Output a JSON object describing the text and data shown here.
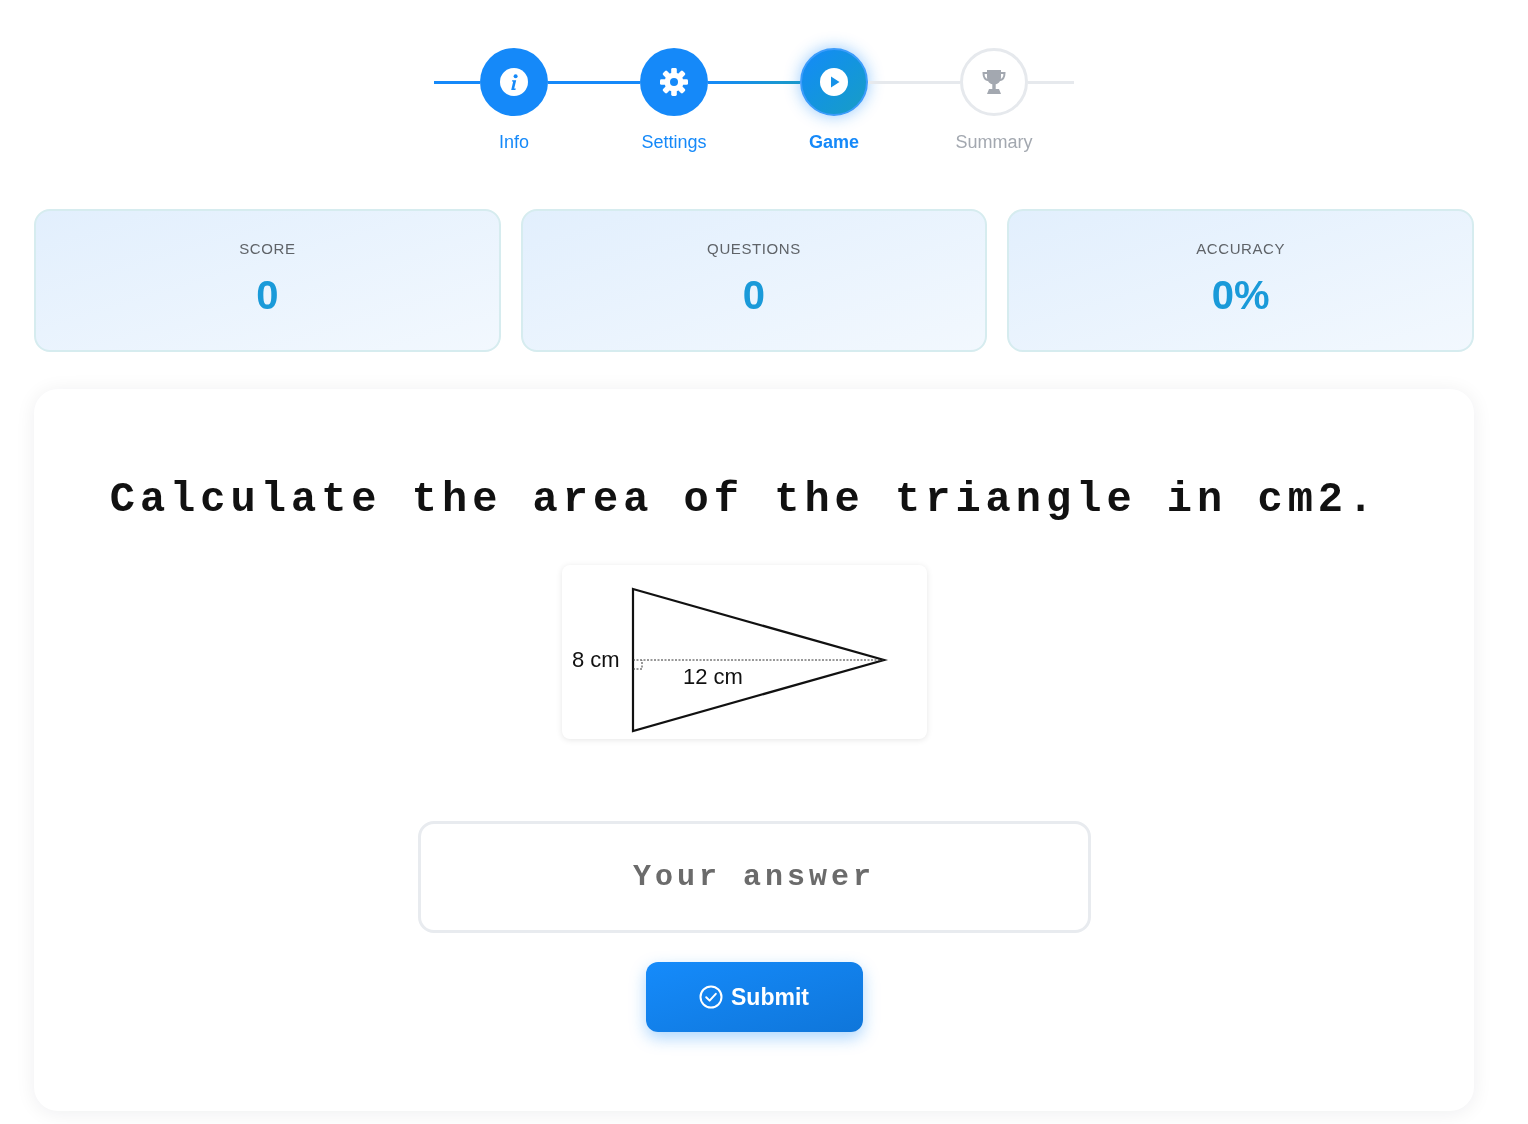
{
  "stepper": {
    "steps": [
      {
        "label": "Info",
        "completed": true,
        "selected": false
      },
      {
        "label": "Settings",
        "completed": true,
        "selected": false
      },
      {
        "label": "Game",
        "completed": false,
        "selected": true
      },
      {
        "label": "Summary",
        "completed": false,
        "selected": false
      }
    ]
  },
  "stats": [
    {
      "label": "SCORE",
      "value": "0"
    },
    {
      "label": "QUESTIONS",
      "value": "0"
    },
    {
      "label": "ACCURACY",
      "value": "0%"
    }
  ],
  "question": {
    "text": "Calculate the area of the triangle in cm2.",
    "diagram": {
      "labels": [
        "8 cm",
        "12 cm"
      ]
    }
  },
  "answer": {
    "placeholder": "Your answer"
  },
  "submit": {
    "label": "Submit"
  }
}
